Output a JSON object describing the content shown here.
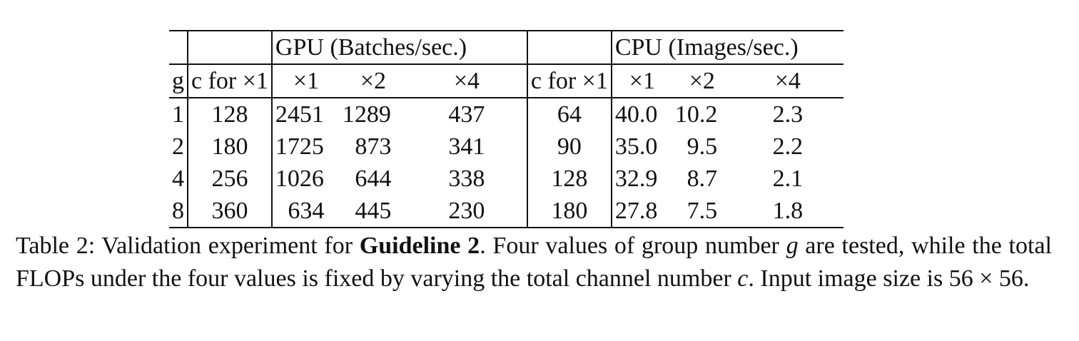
{
  "table": {
    "header_group": {
      "gpu": "GPU (Batches/sec.)",
      "cpu": "CPU (Images/sec.)"
    },
    "columns": [
      "g",
      "c for ×1",
      "×1",
      "×2",
      "×4",
      "c for ×1",
      "×1",
      "×2",
      "×4"
    ],
    "rows": [
      [
        "1",
        "128",
        "2451",
        "1289",
        "437",
        "64",
        "40.0",
        "10.2",
        "2.3"
      ],
      [
        "2",
        "180",
        "1725",
        "873",
        "341",
        "90",
        "35.0",
        "9.5",
        "2.2"
      ],
      [
        "4",
        "256",
        "1026",
        "644",
        "338",
        "128",
        "32.9",
        "8.7",
        "2.1"
      ],
      [
        "8",
        "360",
        "634",
        "445",
        "230",
        "180",
        "27.8",
        "7.5",
        "1.8"
      ]
    ]
  },
  "caption": {
    "prefix": "Table 2: Validation experiment for ",
    "bold": "Guideline 2",
    "mid1": ". Four values of group number ",
    "var_g": "g",
    "mid2": " are tested, while the total FLOPs under the four values is fixed by varying the total channel number ",
    "var_c": "c",
    "suffix": ". Input image size is 56 × 56."
  }
}
